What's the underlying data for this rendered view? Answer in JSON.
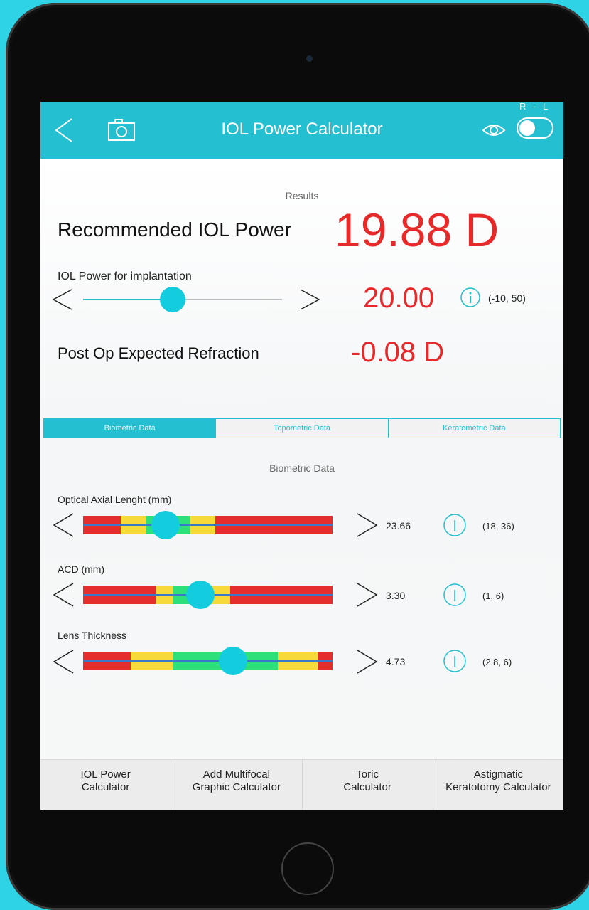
{
  "navbar": {
    "title": "IOL Power Calculator",
    "rl_label": "R - L",
    "icons": [
      "back-chevron-icon",
      "camera-icon",
      "eye-icon"
    ],
    "toggle_on": false
  },
  "results": {
    "section_label": "Results",
    "recommended_label": "Recommended IOL Power",
    "recommended_value": "19.88 D",
    "implantation_label": "IOL Power for implantation",
    "implantation_value": "20.00",
    "implantation_range": "(-10, 50)",
    "implantation_slider_fraction": 0.45,
    "postop_label": "Post Op Expected Refraction",
    "postop_value": "-0.08 D"
  },
  "tabs": [
    {
      "label": "Biometric Data",
      "active": true
    },
    {
      "label": "Topometric Data",
      "active": false
    },
    {
      "label": "Keratometric Data",
      "active": false
    }
  ],
  "biometric": {
    "section_title": "Biometric Data",
    "rows": [
      {
        "label": "Optical Axial Lenght (mm)",
        "value": "23.66",
        "range": "(18, 36)",
        "thumb_fraction": 0.33,
        "zones": [
          {
            "from": 0.0,
            "to": 0.15,
            "color": "#e52d2d"
          },
          {
            "from": 0.15,
            "to": 0.25,
            "color": "#f8d93a"
          },
          {
            "from": 0.25,
            "to": 0.43,
            "color": "#2ee07a"
          },
          {
            "from": 0.43,
            "to": 0.53,
            "color": "#f8d93a"
          },
          {
            "from": 0.53,
            "to": 1.0,
            "color": "#e52d2d"
          }
        ]
      },
      {
        "label": "ACD (mm)",
        "value": "3.30",
        "range": "(1, 6)",
        "thumb_fraction": 0.47,
        "zones": [
          {
            "from": 0.0,
            "to": 0.29,
            "color": "#e52d2d"
          },
          {
            "from": 0.29,
            "to": 0.36,
            "color": "#f8d93a"
          },
          {
            "from": 0.36,
            "to": 0.51,
            "color": "#2ee07a"
          },
          {
            "from": 0.51,
            "to": 0.59,
            "color": "#f8d93a"
          },
          {
            "from": 0.59,
            "to": 1.0,
            "color": "#e52d2d"
          }
        ]
      },
      {
        "label": "Lens Thickness",
        "value": "4.73",
        "range": "(2.8, 6)",
        "thumb_fraction": 0.6,
        "zones": [
          {
            "from": 0.0,
            "to": 0.19,
            "color": "#e52d2d"
          },
          {
            "from": 0.19,
            "to": 0.36,
            "color": "#f8d93a"
          },
          {
            "from": 0.36,
            "to": 0.78,
            "color": "#2ee07a"
          },
          {
            "from": 0.78,
            "to": 0.94,
            "color": "#f8d93a"
          },
          {
            "from": 0.94,
            "to": 1.0,
            "color": "#e52d2d"
          }
        ]
      }
    ]
  },
  "tabbar": [
    {
      "line1": "IOL Power",
      "line2": "Calculator"
    },
    {
      "line1": "Add Multifocal",
      "line2": "Graphic Calculator"
    },
    {
      "line1": "Toric",
      "line2": "Calculator"
    },
    {
      "line1": "Astigmatic",
      "line2": "Keratotomy Calculator"
    }
  ],
  "colors": {
    "accent": "#24bfd1",
    "value_red": "#e8292a",
    "thumb": "#13ccde"
  }
}
